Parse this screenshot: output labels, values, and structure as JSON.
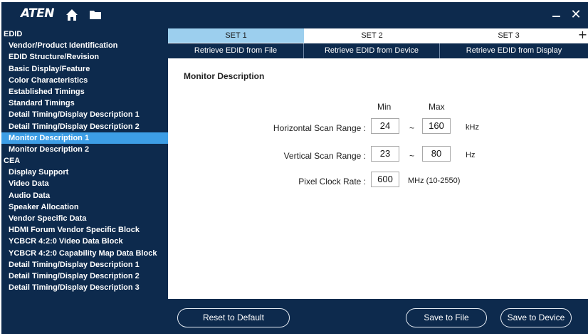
{
  "titlebar": {
    "logo": "ATEN",
    "home_icon": "home-icon",
    "folder_icon": "folder-icon",
    "close_label": "✕"
  },
  "sidebar": {
    "items": [
      {
        "label": "EDID",
        "type": "section"
      },
      {
        "label": "Vendor/Product Identification",
        "type": "item"
      },
      {
        "label": "EDID Structure/Revision",
        "type": "item"
      },
      {
        "label": "Basic Display/Feature",
        "type": "item"
      },
      {
        "label": "Color Characteristics",
        "type": "item"
      },
      {
        "label": "Established Timings",
        "type": "item"
      },
      {
        "label": "Standard Timings",
        "type": "item"
      },
      {
        "label": "Detail Timing/Display Description 1",
        "type": "item"
      },
      {
        "label": "Detail Timing/Display Description 2",
        "type": "item"
      },
      {
        "label": "Monitor Description 1",
        "type": "item",
        "selected": true
      },
      {
        "label": "Monitor Description 2",
        "type": "item"
      },
      {
        "label": "CEA",
        "type": "section"
      },
      {
        "label": "Display Support",
        "type": "item"
      },
      {
        "label": "Video Data",
        "type": "item"
      },
      {
        "label": "Audio Data",
        "type": "item"
      },
      {
        "label": "Speaker Allocation",
        "type": "item"
      },
      {
        "label": "Vendor Specific Data",
        "type": "item"
      },
      {
        "label": "HDMI Forum Vendor Specific Block",
        "type": "item"
      },
      {
        "label": "YCBCR 4:2:0 Video Data Block",
        "type": "item"
      },
      {
        "label": "YCBCR 4:2:0 Capability Map Data Block",
        "type": "item"
      },
      {
        "label": "Detail Timing/Display Description 1",
        "type": "item"
      },
      {
        "label": "Detail Timing/Display Description 2",
        "type": "item"
      },
      {
        "label": "Detail Timing/Display Description 3",
        "type": "item"
      }
    ]
  },
  "tabs": {
    "set1": "SET 1",
    "set2": "SET 2",
    "set3": "SET 3",
    "add": "+"
  },
  "actions": {
    "from_file": "Retrieve EDID from File",
    "from_device": "Retrieve EDID from Device",
    "from_display": "Retrieve EDID from Display"
  },
  "content": {
    "title": "Monitor Description",
    "min_header": "Min",
    "max_header": "Max",
    "horizontal": {
      "label": "Horizontal Scan Range :",
      "min": "24",
      "max": "160",
      "unit": "kHz"
    },
    "vertical": {
      "label": "Vertical Scan Range :",
      "min": "23",
      "max": "80",
      "unit": "Hz"
    },
    "pixel_clock": {
      "label": "Pixel Clock Rate :",
      "value": "600",
      "unit": "MHz (10-2550)"
    },
    "tilde": "~"
  },
  "footer": {
    "reset": "Reset to Default",
    "save_file": "Save to File",
    "save_device": "Save to Device"
  },
  "colors": {
    "navy": "#0d2a4d",
    "selected": "#3d9ee6",
    "active_tab": "#9ccfee"
  }
}
